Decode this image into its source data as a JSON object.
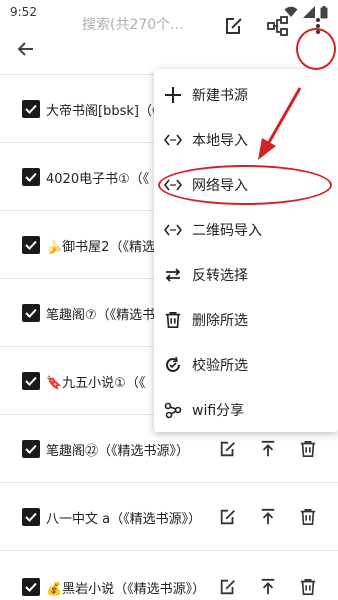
{
  "status_bar": {
    "time": "9:52"
  },
  "toolbar": {
    "search_placeholder": "搜索(共270个..."
  },
  "list": {
    "items": [
      {
        "label": "大帝书阁[bbsk]（《"
      },
      {
        "label": "4020电子书①（《"
      },
      {
        "label": "🍌御书屋2（《精选"
      },
      {
        "label": "笔趣阁⑦（《精选书"
      },
      {
        "label": "🔖九五小说①（《"
      },
      {
        "label": "笔趣阁㉒（《精选书源》）"
      },
      {
        "label": "八一中文 a（《精选书源》）"
      },
      {
        "label": "💰黑岩小说（《精选书源》）"
      }
    ]
  },
  "menu": {
    "items": [
      {
        "label": "新建书源",
        "icon": "plus-icon"
      },
      {
        "label": "本地导入",
        "icon": "code-icon"
      },
      {
        "label": "网络导入",
        "icon": "code-icon"
      },
      {
        "label": "二维码导入",
        "icon": "code-icon"
      },
      {
        "label": "反转选择",
        "icon": "swap-icon"
      },
      {
        "label": "删除所选",
        "icon": "trash-icon"
      },
      {
        "label": "校验所选",
        "icon": "check-refresh-icon"
      },
      {
        "label": "wifi分享",
        "icon": "share-icon"
      }
    ]
  },
  "colors": {
    "annotation": "#d32222",
    "checkbox": "#1a1a1a"
  }
}
